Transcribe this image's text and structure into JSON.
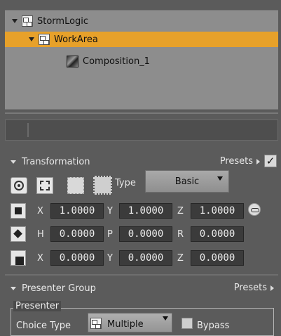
{
  "tree": {
    "items": [
      {
        "label": "StormLogic"
      },
      {
        "label": "WorkArea"
      },
      {
        "label": "Composition_1"
      }
    ]
  },
  "transformation": {
    "title": "Transformation",
    "presets_label": "Presets",
    "enabled_check": "✓",
    "type_label": "Type",
    "type_value": "Basic",
    "rows": [
      {
        "axes": [
          "X",
          "Y",
          "Z"
        ],
        "values": [
          "1.0000",
          "1.0000",
          "1.0000"
        ]
      },
      {
        "axes": [
          "H",
          "P",
          "R"
        ],
        "values": [
          "0.0000",
          "0.0000",
          "0.0000"
        ]
      },
      {
        "axes": [
          "X",
          "Y",
          "Z"
        ],
        "values": [
          "0.0000",
          "0.0000",
          "0.0000"
        ]
      }
    ]
  },
  "presenter_group": {
    "title": "Presenter Group",
    "presets_label": "Presets",
    "group_title": "Presenter",
    "choice_type_label": "Choice Type",
    "choice_type_value": "Multiple",
    "bypass_label": "Bypass",
    "bypass_checked": false
  },
  "colors": {
    "selection": "#e7a12a",
    "panel": "#5b5b5b",
    "tree_bg": "#8d8d8d",
    "field_bg": "#3b3b3b"
  }
}
